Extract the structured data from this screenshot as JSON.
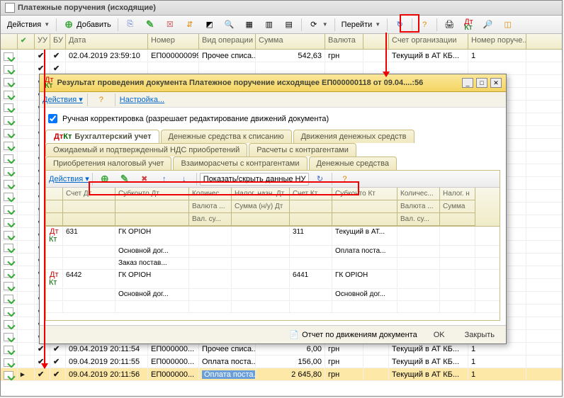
{
  "window": {
    "title": "Платежные поручения (исходящие)"
  },
  "toolbar": {
    "actions": "Действия",
    "add": "Добавить",
    "goto": "Перейти"
  },
  "grid": {
    "headers": {
      "uu": "УУ",
      "bu": "БУ",
      "date": "Дата",
      "num": "Номер",
      "op": "Вид операции",
      "sum": "Сумма",
      "cur": "Валюта",
      "org": "Счет организации",
      "nord": "Номер поруче..."
    },
    "rows": [
      {
        "uu": "✔",
        "bu": "✔",
        "date": "02.04.2019 23:59:10",
        "num": "ЕП000000099",
        "op": "Прочее списа...",
        "sum": "542,63",
        "cur": "грн",
        "org": "Текущий в АТ КБ...",
        "nord": "1"
      },
      {
        "uu": "✔",
        "bu": "✔",
        "date": "",
        "num": "",
        "op": "",
        "sum": "",
        "cur": "",
        "org": "",
        "nord": ""
      },
      {
        "uu": "✔",
        "bu": "✔",
        "date": "",
        "num": "",
        "op": "",
        "sum": "",
        "cur": "",
        "org": "",
        "nord": ""
      },
      {
        "uu": "✔",
        "bu": "✔",
        "date": "",
        "num": "",
        "op": "",
        "sum": "",
        "cur": "",
        "org": "",
        "nord": ""
      },
      {
        "uu": "✔",
        "bu": "✔",
        "date": "",
        "num": "",
        "op": "",
        "sum": "",
        "cur": "",
        "org": "",
        "nord": ""
      },
      {
        "uu": "✔",
        "bu": "✔",
        "date": "",
        "num": "",
        "op": "",
        "sum": "",
        "cur": "",
        "org": "",
        "nord": ""
      },
      {
        "uu": "✔",
        "bu": "✔",
        "date": "",
        "num": "",
        "op": "",
        "sum": "",
        "cur": "",
        "org": "",
        "nord": ""
      },
      {
        "uu": "✔",
        "bu": "✔",
        "date": "",
        "num": "",
        "op": "",
        "sum": "",
        "cur": "",
        "org": "",
        "nord": ""
      },
      {
        "uu": "✔",
        "bu": "✔",
        "date": "",
        "num": "",
        "op": "",
        "sum": "",
        "cur": "",
        "org": "",
        "nord": ""
      },
      {
        "uu": "✔",
        "bu": "✔",
        "date": "",
        "num": "",
        "op": "",
        "sum": "",
        "cur": "",
        "org": "",
        "nord": ""
      },
      {
        "uu": "✔",
        "bu": "✔",
        "date": "",
        "num": "",
        "op": "",
        "sum": "",
        "cur": "",
        "org": "",
        "nord": ""
      },
      {
        "uu": "✔",
        "bu": "✔",
        "date": "",
        "num": "",
        "op": "",
        "sum": "",
        "cur": "",
        "org": "",
        "nord": ""
      },
      {
        "uu": "✔",
        "bu": "✔",
        "date": "",
        "num": "",
        "op": "",
        "sum": "",
        "cur": "",
        "org": "",
        "nord": ""
      },
      {
        "uu": "✔",
        "bu": "✔",
        "date": "",
        "num": "",
        "op": "",
        "sum": "",
        "cur": "",
        "org": "",
        "nord": ""
      },
      {
        "uu": "✔",
        "bu": "✔",
        "date": "",
        "num": "",
        "op": "",
        "sum": "",
        "cur": "",
        "org": "",
        "nord": ""
      },
      {
        "uu": "✔",
        "bu": "✔",
        "date": "",
        "num": "",
        "op": "",
        "sum": "",
        "cur": "",
        "org": "",
        "nord": ""
      },
      {
        "uu": "✔",
        "bu": "✔",
        "date": "",
        "num": "",
        "op": "",
        "sum": "",
        "cur": "",
        "org": "",
        "nord": ""
      },
      {
        "uu": "✔",
        "bu": "✔",
        "date": "",
        "num": "",
        "op": "",
        "sum": "",
        "cur": "",
        "org": "",
        "nord": ""
      },
      {
        "uu": "✔",
        "bu": "✔",
        "date": "",
        "num": "",
        "op": "",
        "sum": "",
        "cur": "",
        "org": "",
        "nord": ""
      },
      {
        "uu": "✔",
        "bu": "✔",
        "date": "",
        "num": "",
        "op": "",
        "sum": "",
        "cur": "",
        "org": "",
        "nord": ""
      },
      {
        "uu": "✔",
        "bu": "✔",
        "date": "",
        "num": "",
        "op": "",
        "sum": "",
        "cur": "",
        "org": "",
        "nord": ""
      },
      {
        "uu": "✔",
        "bu": "✔",
        "date": "",
        "num": "",
        "op": "",
        "sum": "",
        "cur": "",
        "org": "",
        "nord": ""
      },
      {
        "uu": "✔",
        "bu": "✔",
        "date": "",
        "num": "",
        "op": "",
        "sum": "",
        "cur": "",
        "org": "",
        "nord": ""
      },
      {
        "uu": "✔",
        "bu": "✔",
        "date": "09.04.2019 20:11:54",
        "num": "ЕП000000...",
        "op": "Прочее списа...",
        "sum": "6,00",
        "cur": "грн",
        "org": "Текущий в АТ КБ...",
        "nord": "1"
      },
      {
        "uu": "✔",
        "bu": "✔",
        "date": "09.04.2019 20:11:55",
        "num": "ЕП000000...",
        "op": "Оплата поста...",
        "sum": "156,00",
        "cur": "грн",
        "org": "Текущий в АТ КБ...",
        "nord": "1"
      },
      {
        "uu": "✔",
        "bu": "✔",
        "date": "09.04.2019 20:11:56",
        "num": "ЕП000000...",
        "op": "Оплата поста...",
        "sum": "2 645,80",
        "cur": "грн",
        "org": "Текущий в АТ КБ...",
        "nord": "1",
        "sel": true
      }
    ]
  },
  "modal": {
    "title": "Результат проведения документа Платежное поручение исходящее ЕП000000118 от 09.04....:56",
    "actions": "Действия",
    "settings": "Настройка...",
    "manual_edit": "Ручная корректировка (разрешает редактирование движений документа)",
    "tabs": {
      "t1": "Бухгалтерский учет",
      "t2": "Денежные средства к списанию",
      "t3": "Движения денежных средств",
      "t4": "Ожидаемый и подтвержденный НДС приобретений",
      "t5": "Расчеты с контрагентами",
      "t6": "Приобретения налоговый учет",
      "t7": "Взаиморасчеты с контрагентами",
      "t8": "Денежные средства"
    },
    "inner_toolbar": {
      "actions": "Действия",
      "toggle": "Показать/скрыть данные НУ"
    },
    "inner_headers": {
      "acdt": "Счет Дт",
      "sub": "Субконто Дт",
      "qty": "Количес...",
      "tax": "Налог. назн. Дт",
      "ackt": "Счет Кт",
      "subk": "Субконто Кт",
      "qtyk": "Количес...",
      "taxk": "Налог. н",
      "val": "Валюта ...",
      "sumnu": "Сумма (н/у) Дт",
      "valk": "Валюта ...",
      "sumk": "Сумма",
      "valsu": "Вал. су...",
      "valsuk": "Вал. су..."
    },
    "inner_rows": [
      {
        "acdt": "631",
        "sub1": "ГК ОРІОН",
        "sub2": "Основной дог...",
        "sub3": "Заказ постав...",
        "ackt": "311",
        "subk1": "Текущий в АТ...",
        "subk2": "Оплата поста..."
      },
      {
        "acdt": "6442",
        "sub1": "ГК ОРІОН",
        "sub2": "Основной дог...",
        "ackt": "6441",
        "subk1": "ГК ОРІОН",
        "subk2": "Основной дог..."
      }
    ],
    "footer": {
      "report": "Отчет по движениям документа",
      "ok": "OK",
      "close": "Закрыть"
    }
  }
}
